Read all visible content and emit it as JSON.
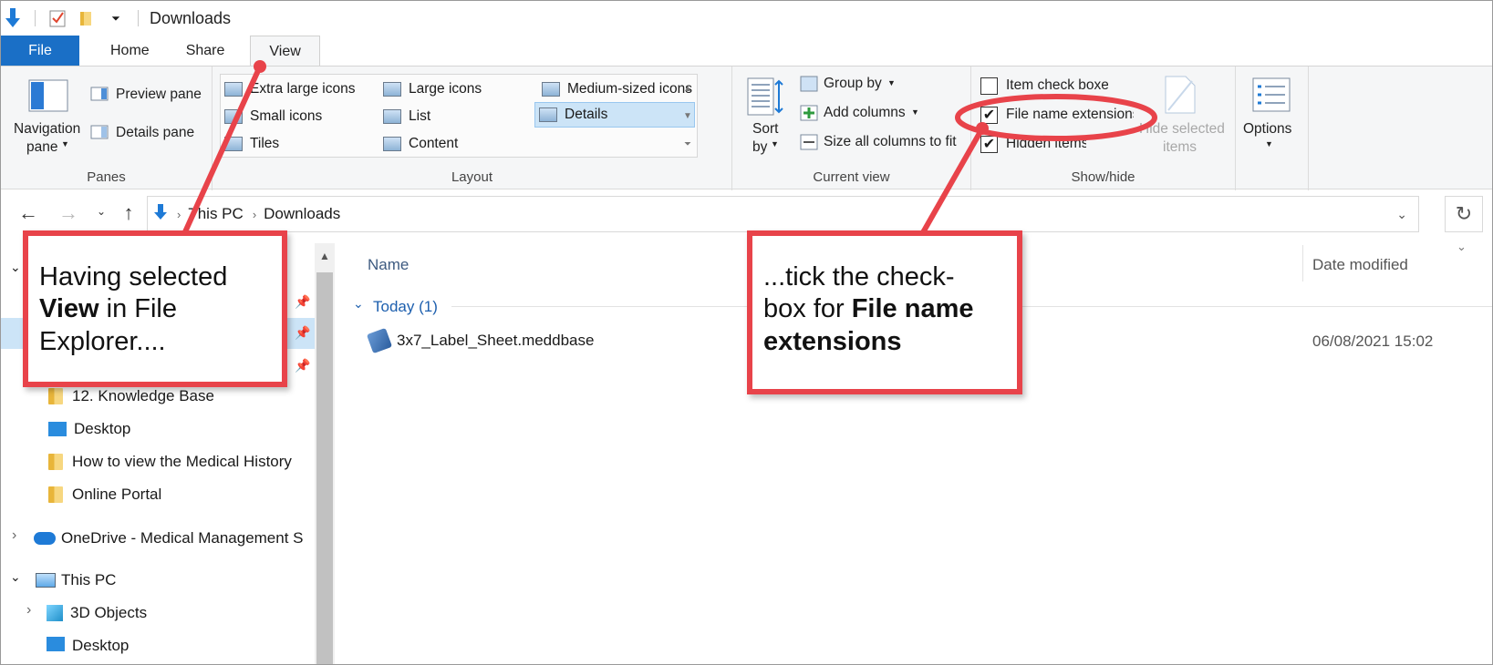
{
  "window": {
    "title": "Downloads"
  },
  "tabs": {
    "file": "File",
    "home": "Home",
    "share": "Share",
    "view": "View"
  },
  "ribbon": {
    "panes": {
      "navigation_pane": "Navigation",
      "navigation_pane_2": "pane",
      "preview_pane": "Preview pane",
      "details_pane": "Details pane",
      "label": "Panes"
    },
    "layout": {
      "items": [
        "Extra large icons",
        "Large icons",
        "Medium-sized icons",
        "Small icons",
        "List",
        "Details",
        "Tiles",
        "Content"
      ],
      "selected": "Details",
      "label": "Layout"
    },
    "current_view": {
      "sort_by": "Sort",
      "sort_by_2": "by",
      "group_by": "Group by",
      "add_columns": "Add columns",
      "size_all": "Size all columns to fit",
      "label": "Current view"
    },
    "show_hide": {
      "item_check_boxes": "Item check boxes",
      "file_name_extensions": "File name extensions",
      "hidden_items": "Hidden items",
      "hide_selected": "Hide selected",
      "hide_selected_2": "items",
      "label": "Show/hide",
      "item_check_boxes_checked": false,
      "file_name_extensions_checked": true,
      "hidden_items_checked": true
    },
    "options": {
      "label": "Options"
    }
  },
  "address": {
    "crumb1": "This PC",
    "crumb2": "Downloads"
  },
  "navpane": {
    "items": [
      "12. Knowledge Base",
      "Desktop",
      "How to view the Medical History",
      "Online Portal",
      "OneDrive - Medical Management S",
      "This PC",
      "3D Objects",
      "Desktop"
    ]
  },
  "content": {
    "col_name": "Name",
    "col_date": "Date modified",
    "group": "Today (1)",
    "files": [
      {
        "name": "3x7_Label_Sheet.meddbase",
        "date": "06/08/2021 15:02"
      }
    ]
  },
  "callouts": {
    "left_line1": "Having selected",
    "left_bold": "View",
    "left_line2_rest": " in File",
    "left_line3": "Explorer....",
    "right_line1": "...tick the check-",
    "right_line2_pre": "box for ",
    "right_bold1": "File name",
    "right_bold2": "extensions"
  },
  "colors": {
    "accent": "#1a6fc6",
    "callout": "#e8434a"
  }
}
